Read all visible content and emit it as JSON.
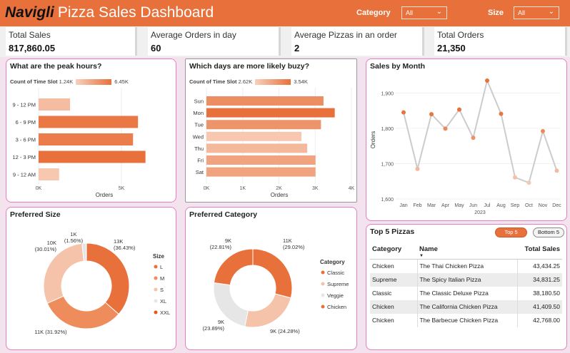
{
  "header": {
    "brand": "Navigli",
    "title": "Pizza Sales Dashboard",
    "filters": [
      {
        "label": "Category",
        "value": "All"
      },
      {
        "label": "Size",
        "value": "All"
      }
    ]
  },
  "kpis": [
    {
      "title": "Total Sales",
      "value": "817,860.05"
    },
    {
      "title": "Average Orders in day",
      "value": "60"
    },
    {
      "title": "Average Pizzas in an order",
      "value": "2"
    },
    {
      "title": "Total Orders",
      "value": "21,350"
    }
  ],
  "colors": {
    "accent": "#e8703a",
    "border": "#e67fbf",
    "line": "#cccccc"
  },
  "peak_hours": {
    "title": "What are the peak hours?",
    "legend_label": "Count of Time Slot",
    "legend_min": "1.24K",
    "legend_max": "6.45K",
    "xlabel": "Orders",
    "ticks": [
      "0K",
      "5K"
    ],
    "chart_data": {
      "type": "bar",
      "categories": [
        "9 - 12 PM",
        "6 - 9 PM",
        "3 - 6 PM",
        "12 - 3 PM",
        "9 - 12 AM"
      ],
      "values": [
        1900,
        6000,
        5700,
        6450,
        1240
      ],
      "xlim": [
        0,
        7500
      ]
    }
  },
  "busy_days": {
    "title": "Which days are more likely buzy?",
    "legend_label": "Count of Time Slot",
    "legend_min": "2.62K",
    "legend_max": "3.54K",
    "xlabel": "Orders",
    "ticks": [
      "0K",
      "1K",
      "2K",
      "3K",
      "4K"
    ],
    "chart_data": {
      "type": "bar",
      "categories": [
        "Sun",
        "Mon",
        "Tue",
        "Wed",
        "Thu",
        "Fri",
        "Sat"
      ],
      "values": [
        3230,
        3540,
        3160,
        2620,
        2780,
        3010,
        3010
      ],
      "xlim": [
        0,
        4000
      ]
    }
  },
  "sales_month": {
    "title": "Sales by Month",
    "ylabel": "Orders",
    "year": "2023",
    "yticks": [
      "1,600",
      "1,700",
      "1,800",
      "1,900"
    ],
    "chart_data": {
      "type": "line",
      "x": [
        "Jan",
        "Feb",
        "Mar",
        "Apr",
        "May",
        "Jun",
        "Jul",
        "Aug",
        "Sep",
        "Oct",
        "Nov",
        "Dec"
      ],
      "values": [
        1845,
        1685,
        1840,
        1799,
        1853,
        1773,
        1935,
        1841,
        1661,
        1646,
        1792,
        1680
      ],
      "ylim": [
        1600,
        1935
      ]
    }
  },
  "pref_size": {
    "title": "Preferred Size",
    "legend_title": "Size",
    "chart_data": {
      "type": "pie",
      "labels": [
        "L",
        "M",
        "S",
        "XL",
        "XXL"
      ],
      "values": [
        36.43,
        31.92,
        30.01,
        1.56,
        0.08
      ],
      "colors": [
        "#e8703a",
        "#ef8c5c",
        "#f5c2aa",
        "#e6e6e6",
        "#e05a20"
      ]
    },
    "slice_labels": [
      {
        "line1": "13K",
        "line2": "(36.43%)"
      },
      {
        "line1": "11K (31.92%)",
        "line2": ""
      },
      {
        "line1": "10K",
        "line2": "(30.01%)"
      },
      {
        "line1": "1K",
        "line2": "(1.56%)"
      }
    ]
  },
  "pref_category": {
    "title": "Preferred Category",
    "legend_title": "Category",
    "chart_data": {
      "type": "pie",
      "labels": [
        "Classic",
        "Supreme",
        "Veggie",
        "Chicken"
      ],
      "values": [
        29.02,
        24.28,
        23.89,
        22.81
      ],
      "colors": [
        "#e8703a",
        "#f5c2aa",
        "#e6e6e6",
        "#e8703a"
      ]
    },
    "slice_labels": [
      {
        "line1": "11K",
        "line2": "(29.02%)"
      },
      {
        "line1": "9K (24.28%)",
        "line2": ""
      },
      {
        "line1": "9K",
        "line2": "(23.89%)"
      },
      {
        "line1": "9K",
        "line2": "(22.81%)"
      }
    ]
  },
  "top5": {
    "title": "Top 5 Pizzas",
    "toggle_on": "Top 5",
    "toggle_off": "Bottom 5",
    "columns": [
      "Category",
      "Name",
      "Total Sales"
    ],
    "rows": [
      [
        "Chicken",
        "The Thai Chicken Pizza",
        "43,434.25"
      ],
      [
        "Supreme",
        "The Spicy Italian Pizza",
        "34,831.25"
      ],
      [
        "Classic",
        "The Classic Deluxe Pizza",
        "38,180.50"
      ],
      [
        "Chicken",
        "The California Chicken Pizza",
        "41,409.50"
      ],
      [
        "Chicken",
        "The Barbecue Chicken Pizza",
        "42,768.00"
      ]
    ]
  }
}
